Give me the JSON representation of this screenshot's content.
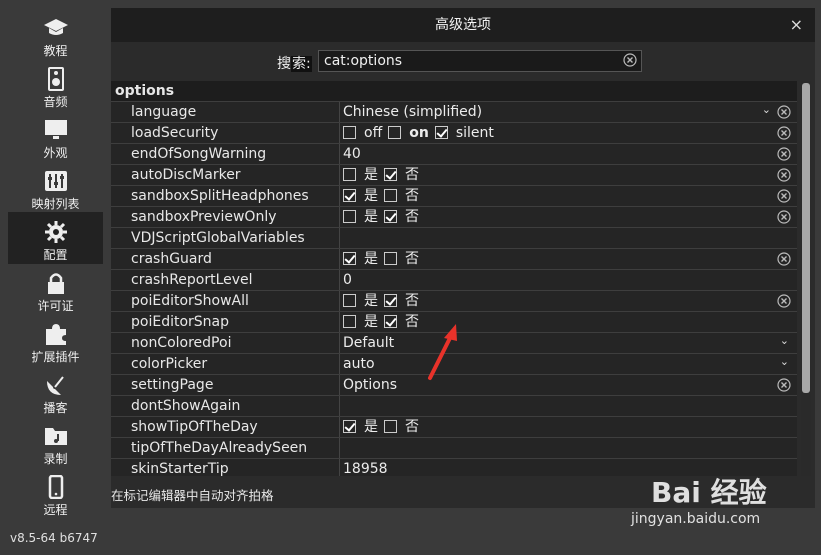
{
  "sidebar": {
    "items": [
      {
        "label": "教程",
        "icon": "graduation-cap-icon"
      },
      {
        "label": "音频",
        "icon": "speaker-icon"
      },
      {
        "label": "外观",
        "icon": "monitor-icon"
      },
      {
        "label": "映射列表",
        "icon": "sliders-icon"
      },
      {
        "label": "配置",
        "icon": "gear-icon",
        "active": true
      },
      {
        "label": "许可证",
        "icon": "lock-icon"
      },
      {
        "label": "扩展插件",
        "icon": "puzzle-icon"
      },
      {
        "label": "播客",
        "icon": "satellite-dish-icon"
      },
      {
        "label": "录制",
        "icon": "folder-music-icon"
      },
      {
        "label": "远程",
        "icon": "phone-icon"
      }
    ],
    "version": "v8.5-64 b6747"
  },
  "dialog": {
    "title": "高级选项",
    "close": "×",
    "search_label_prefix": "搜",
    "search_label_hl": "索:",
    "search_value": "cat:options",
    "hint": "在标记编辑器中自动对齐拍格"
  },
  "table": {
    "header": "options",
    "rows": [
      {
        "name": "language",
        "value": "Chinese (simplified)",
        "type": "dropdown",
        "clear": true
      },
      {
        "name": "loadSecurity",
        "type": "tri",
        "options": [
          {
            "label": "off",
            "checked": false
          },
          {
            "label": "on",
            "checked": false,
            "bold": true
          },
          {
            "label": "silent",
            "checked": true
          }
        ],
        "clear": true
      },
      {
        "name": "endOfSongWarning",
        "value": "40",
        "type": "text",
        "clear": true
      },
      {
        "name": "autoDiscMarker",
        "type": "yesno",
        "yes": false,
        "no": true,
        "clear": true
      },
      {
        "name": "sandboxSplitHeadphones",
        "type": "yesno",
        "yes": true,
        "no": false,
        "clear": true
      },
      {
        "name": "sandboxPreviewOnly",
        "type": "yesno",
        "yes": false,
        "no": true,
        "clear": true
      },
      {
        "name": "VDJScriptGlobalVariables",
        "value": "",
        "type": "text",
        "clear": false
      },
      {
        "name": "crashGuard",
        "type": "yesno",
        "yes": true,
        "no": false,
        "clear": true
      },
      {
        "name": "crashReportLevel",
        "value": "0",
        "type": "text",
        "clear": false
      },
      {
        "name": "poiEditorShowAll",
        "type": "yesno",
        "yes": false,
        "no": true,
        "clear": true
      },
      {
        "name": "poiEditorSnap",
        "type": "yesno",
        "yes": false,
        "no": true,
        "clear": false
      },
      {
        "name": "nonColoredPoi",
        "value": "Default",
        "type": "dropdown",
        "clear": false
      },
      {
        "name": "colorPicker",
        "value": "auto",
        "type": "dropdown",
        "clear": false
      },
      {
        "name": "settingPage",
        "value": "Options",
        "type": "text",
        "clear": true
      },
      {
        "name": "dontShowAgain",
        "value": "",
        "type": "text",
        "clear": false
      },
      {
        "name": "showTipOfTheDay",
        "type": "yesno",
        "yes": true,
        "no": false,
        "clear": false
      },
      {
        "name": "tipOfTheDayAlreadySeen",
        "value": "",
        "type": "text",
        "clear": false
      },
      {
        "name": "skinStarterTip",
        "value": "18958",
        "type": "text",
        "clear": false
      }
    ],
    "yes_label": "是",
    "no_label": "否"
  },
  "watermark": {
    "brand": "Bai 经验",
    "url": "jingyan.baidu.com"
  },
  "colors": {
    "background": "#3a3a3a",
    "panel": "#2b2b2b",
    "annotation_arrow": "#e8322a"
  }
}
